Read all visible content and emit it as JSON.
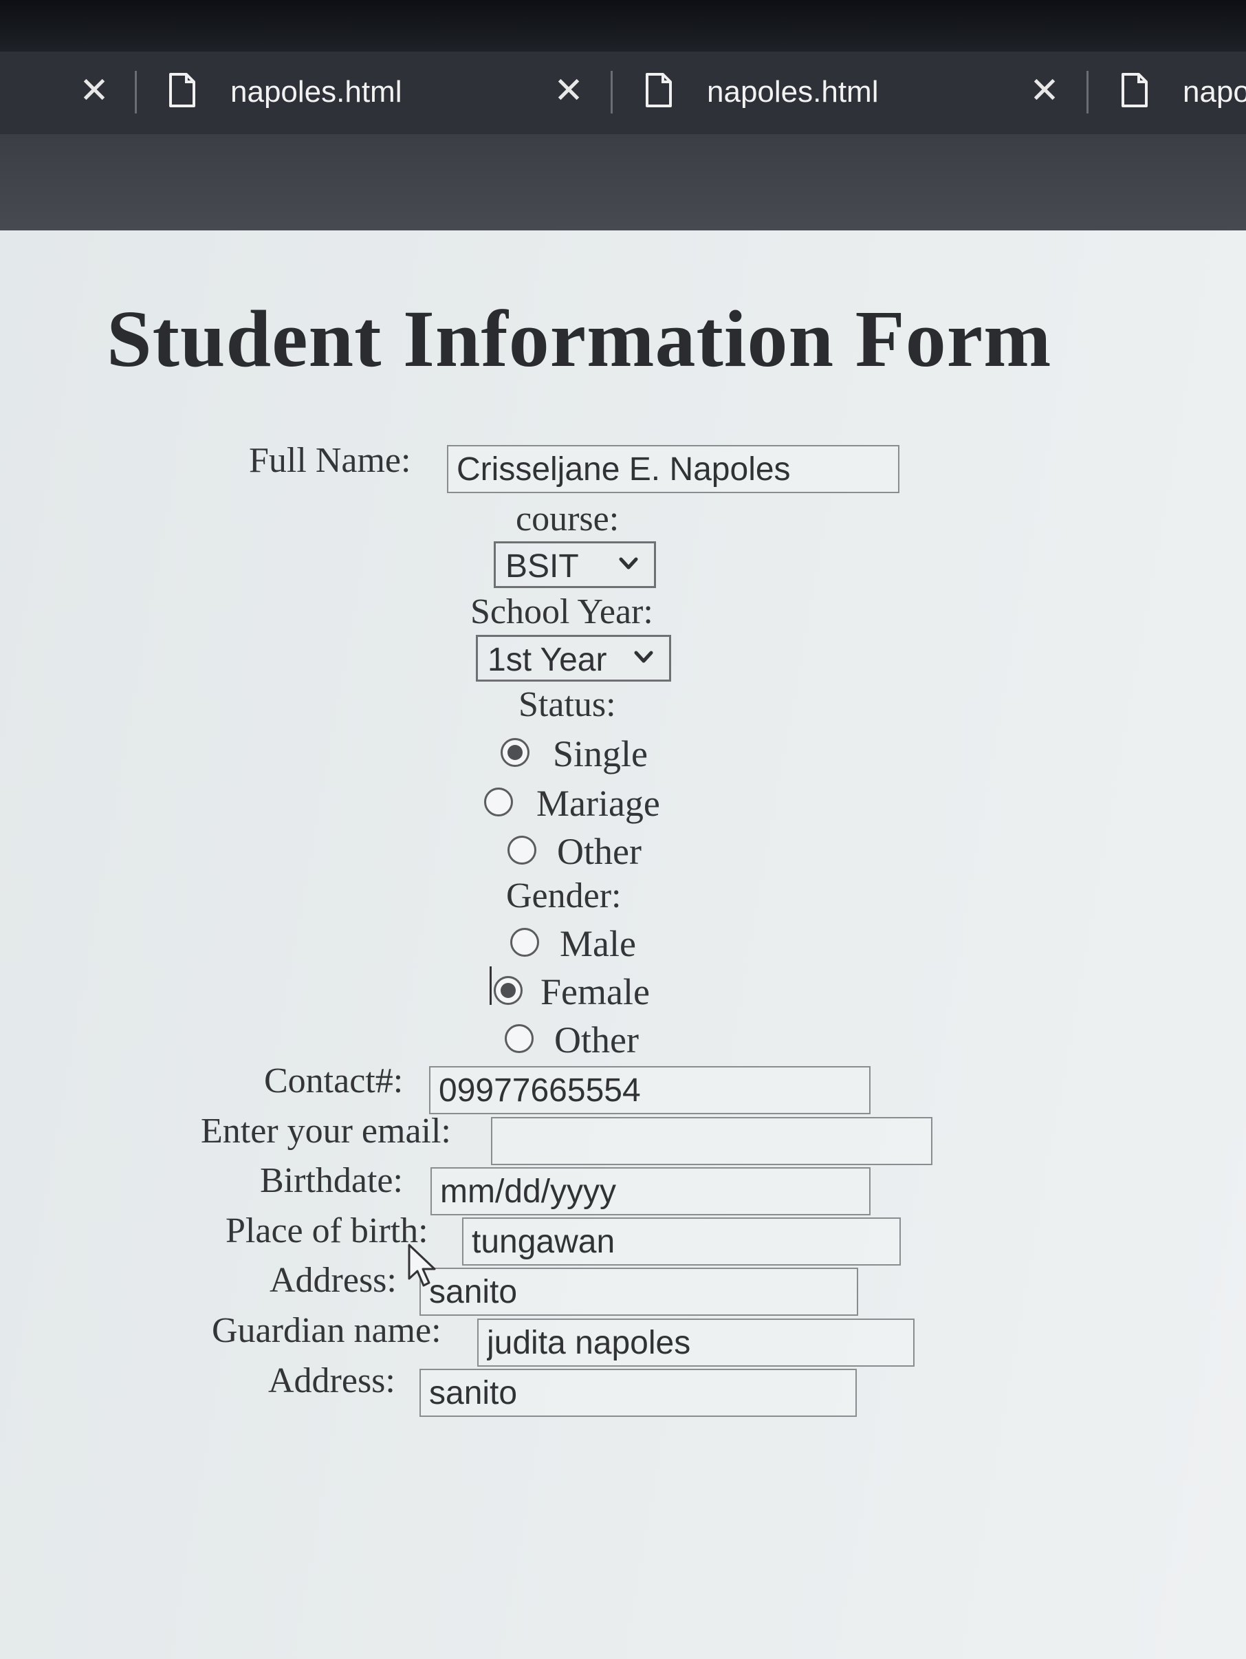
{
  "browser": {
    "tabs": [
      {
        "label": "napoles.html"
      },
      {
        "label": "napoles.html"
      },
      {
        "label": "napoles.html"
      }
    ]
  },
  "form": {
    "title": "Student Information Form",
    "full_name_label": "Full Name:",
    "full_name_value": "Crisseljane E. Napoles",
    "course_label": "course:",
    "course_selected": "BSIT",
    "school_year_label": "School Year:",
    "school_year_selected": "1st Year",
    "status_label": "Status:",
    "status_options": [
      {
        "label": "Single",
        "checked": true
      },
      {
        "label": "Mariage",
        "checked": false
      },
      {
        "label": "Other",
        "checked": false
      }
    ],
    "gender_label": "Gender:",
    "gender_options": [
      {
        "label": "Male",
        "checked": false
      },
      {
        "label": "Female",
        "checked": true
      },
      {
        "label": "Other",
        "checked": false
      }
    ],
    "contact_label": "Contact#:",
    "contact_value": "09977665554",
    "email_label": "Enter your email:",
    "email_value": "",
    "birthdate_label": "Birthdate:",
    "birthdate_placeholder": "mm/dd/yyyy",
    "place_of_birth_label": "Place of birth:",
    "place_of_birth_value": "tungawan",
    "address_label": "Address:",
    "address_value": "sanito",
    "guardian_label": "Guardian name:",
    "guardian_value": "judita napoles",
    "guardian_address_label": "Address:",
    "guardian_address_value": "sanito"
  }
}
